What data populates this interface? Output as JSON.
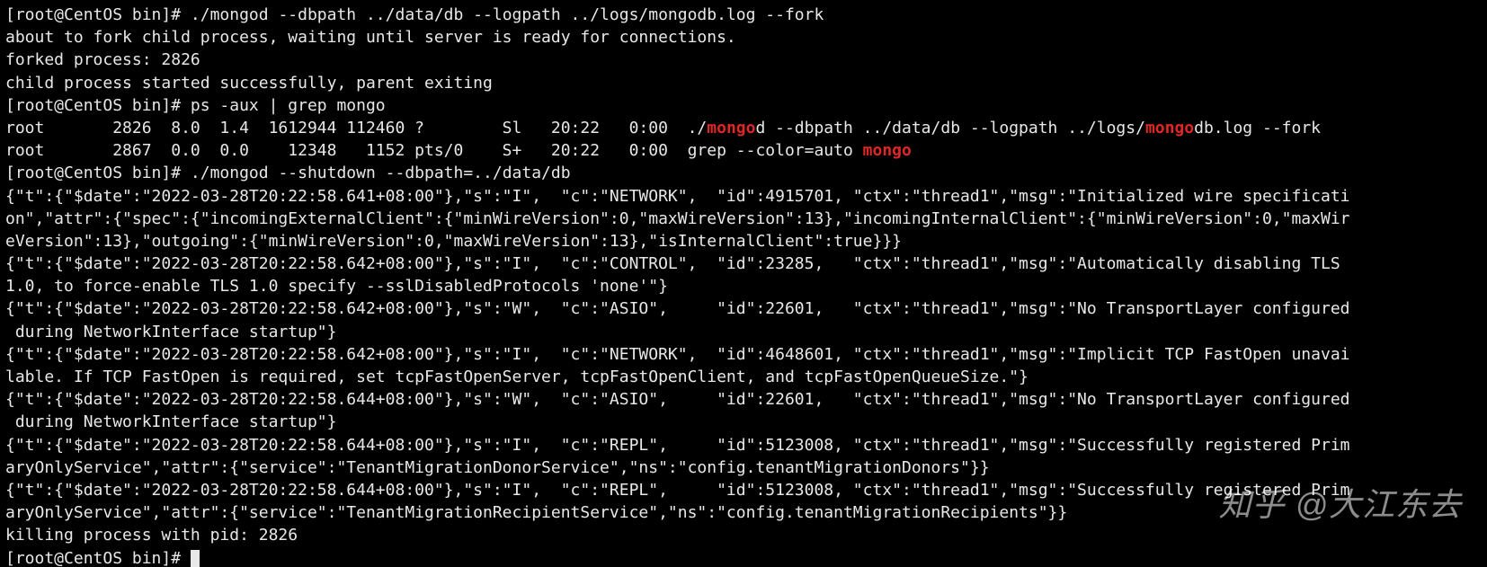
{
  "prompt_user": "root",
  "prompt_host": "CentOS",
  "prompt_dir": "bin",
  "prompt_suffix": "#",
  "cmd1": "./mongod --dbpath ../data/db --logpath ../logs/mongodb.log --fork",
  "out1a": "about to fork child process, waiting until server is ready for connections.",
  "out1b": "forked process: 2826",
  "out1c": "child process started successfully, parent exiting",
  "cmd2": "ps -aux | grep mongo",
  "ps1": {
    "user": "root",
    "pid": "2826",
    "cpu": "8.0",
    "mem": "1.4",
    "vsz": "1612944",
    "rss": "112460",
    "tty": "?",
    "stat": "Sl",
    "start": "20:22",
    "time": "0:00",
    "cmd_pre": "./",
    "cmd_hl1": "mongo",
    "cmd_mid": "d --dbpath ../data/db --logpath ../logs/",
    "cmd_hl2": "mongo",
    "cmd_post": "db.log --fork"
  },
  "ps2": {
    "user": "root",
    "pid": "2867",
    "cpu": "0.0",
    "mem": "0.0",
    "vsz": "12348",
    "rss": "1152",
    "tty": "pts/0",
    "stat": "S+",
    "start": "20:22",
    "time": "0:00",
    "cmd_pre": "grep --color=auto ",
    "cmd_hl": "mongo"
  },
  "cmd3": "./mongod --shutdown --dbpath=../data/db",
  "log1": "{\"t\":{\"$date\":\"2022-03-28T20:22:58.641+08:00\"},\"s\":\"I\",  \"c\":\"NETWORK\",  \"id\":4915701, \"ctx\":\"thread1\",\"msg\":\"Initialized wire specification\",\"attr\":{\"spec\":{\"incomingExternalClient\":{\"minWireVersion\":0,\"maxWireVersion\":13},\"incomingInternalClient\":{\"minWireVersion\":0,\"maxWireVersion\":13},\"outgoing\":{\"minWireVersion\":0,\"maxWireVersion\":13},\"isInternalClient\":true}}}",
  "log2": "{\"t\":{\"$date\":\"2022-03-28T20:22:58.642+08:00\"},\"s\":\"I\",  \"c\":\"CONTROL\",  \"id\":23285,   \"ctx\":\"thread1\",\"msg\":\"Automatically disabling TLS 1.0, to force-enable TLS 1.0 specify --sslDisabledProtocols 'none'\"}",
  "log3": "{\"t\":{\"$date\":\"2022-03-28T20:22:58.642+08:00\"},\"s\":\"W\",  \"c\":\"ASIO\",     \"id\":22601,   \"ctx\":\"thread1\",\"msg\":\"No TransportLayer configured during NetworkInterface startup\"}",
  "log4": "{\"t\":{\"$date\":\"2022-03-28T20:22:58.642+08:00\"},\"s\":\"I\",  \"c\":\"NETWORK\",  \"id\":4648601, \"ctx\":\"thread1\",\"msg\":\"Implicit TCP FastOpen unavailable. If TCP FastOpen is required, set tcpFastOpenServer, tcpFastOpenClient, and tcpFastOpenQueueSize.\"}",
  "log5": "{\"t\":{\"$date\":\"2022-03-28T20:22:58.644+08:00\"},\"s\":\"W\",  \"c\":\"ASIO\",     \"id\":22601,   \"ctx\":\"thread1\",\"msg\":\"No TransportLayer configured during NetworkInterface startup\"}",
  "log6": "{\"t\":{\"$date\":\"2022-03-28T20:22:58.644+08:00\"},\"s\":\"I\",  \"c\":\"REPL\",     \"id\":5123008, \"ctx\":\"thread1\",\"msg\":\"Successfully registered PrimaryOnlyService\",\"attr\":{\"service\":\"TenantMigrationDonorService\",\"ns\":\"config.tenantMigrationDonors\"}}",
  "log7": "{\"t\":{\"$date\":\"2022-03-28T20:22:58.644+08:00\"},\"s\":\"I\",  \"c\":\"REPL\",     \"id\":5123008, \"ctx\":\"thread1\",\"msg\":\"Successfully registered PrimaryOnlyService\",\"attr\":{\"service\":\"TenantMigrationRecipientService\",\"ns\":\"config.tenantMigrationRecipients\"}}",
  "kill": "killing process with pid: 2826",
  "watermark": "知乎 @大江东去"
}
